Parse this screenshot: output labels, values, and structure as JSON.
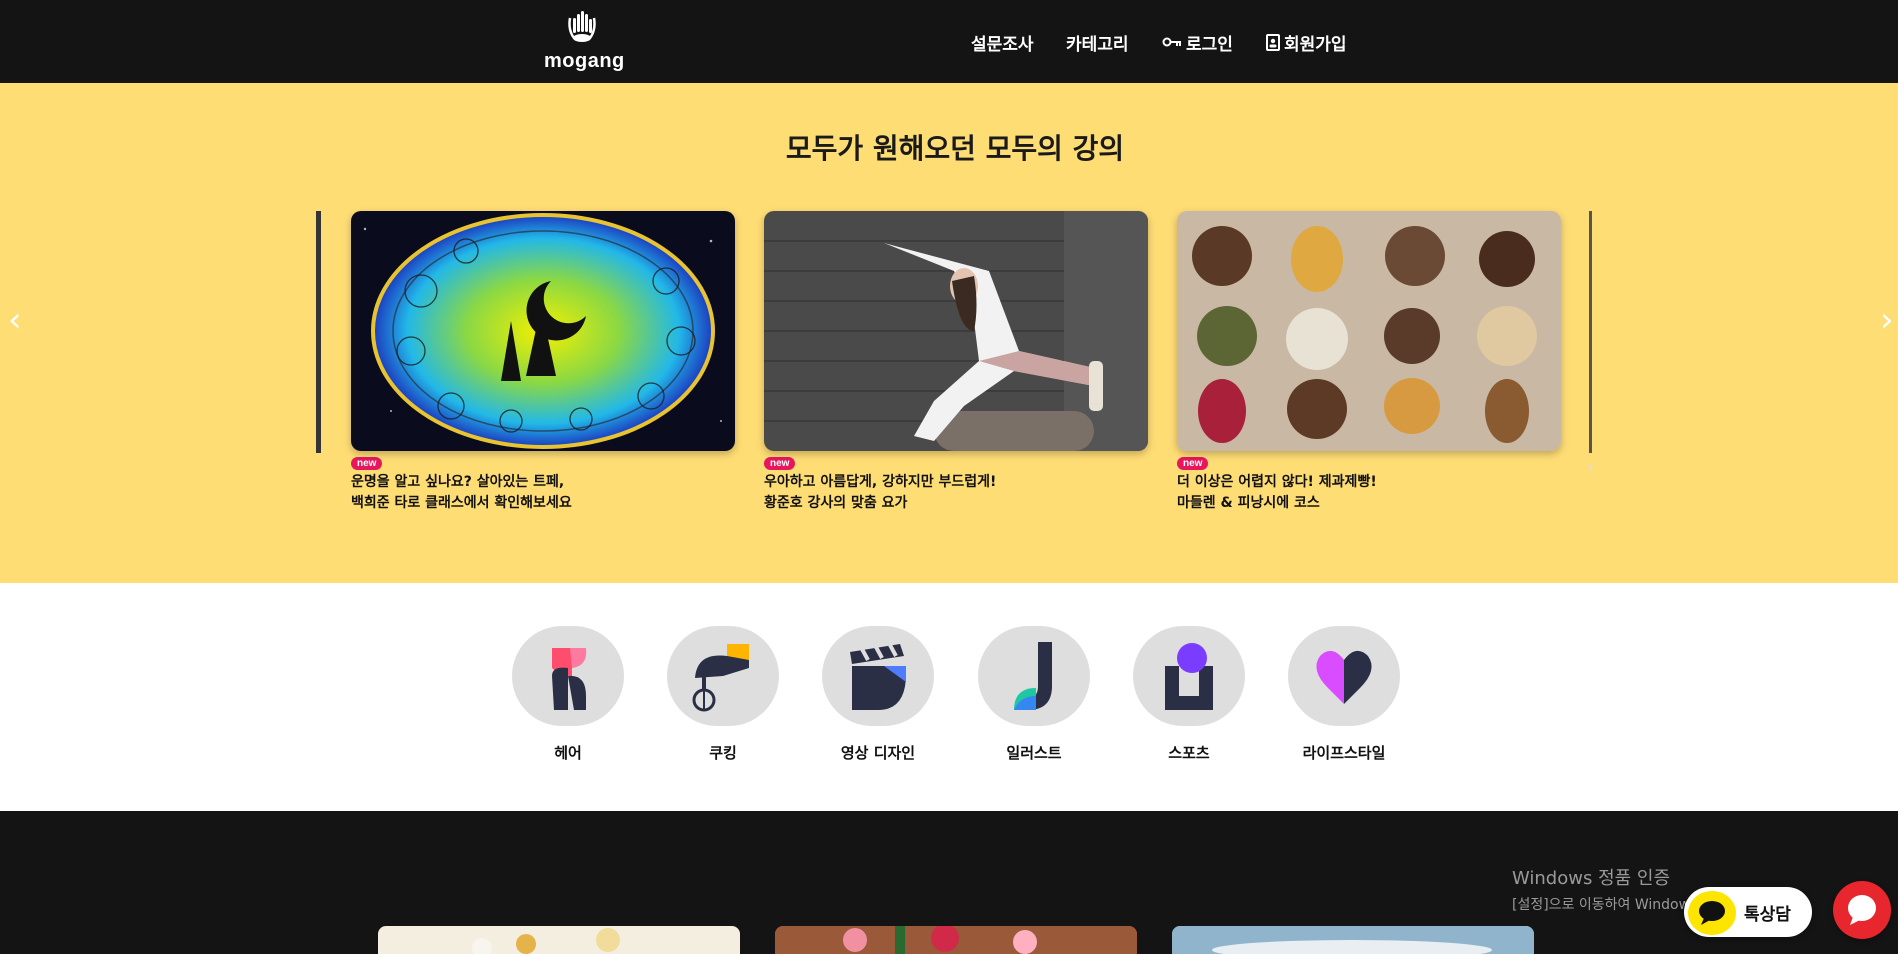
{
  "header": {
    "logo_text": "mogang",
    "nav": [
      {
        "label": "설문조사",
        "icon": ""
      },
      {
        "label": "카테고리",
        "icon": ""
      },
      {
        "label": "로그인",
        "icon": "key-icon"
      },
      {
        "label": "회원가입",
        "icon": "id-card-icon"
      }
    ]
  },
  "hero": {
    "title": "모두가 원해오던 모두의 강의",
    "cards": [
      {
        "badge": "new",
        "line1": "운명을 알고 싶나요? 살아있는 트페,",
        "line2": "백희준 타로 클래스에서 확인해보세요"
      },
      {
        "badge": "new",
        "line1": "우아하고 아름답게, 강하지만 부드럽게!",
        "line2": "황준호 강사의 맞춤 요가"
      },
      {
        "badge": "new",
        "line1": "더 이상은 어렵지 않다! 제과제빵!",
        "line2": "마들렌 & 피낭시에 코스"
      }
    ]
  },
  "categories": [
    {
      "label": "헤어",
      "icon": "hair-icon"
    },
    {
      "label": "쿠킹",
      "icon": "cooking-icon"
    },
    {
      "label": "영상 디자인",
      "icon": "clapperboard-icon"
    },
    {
      "label": "일러스트",
      "icon": "illustration-icon"
    },
    {
      "label": "스포츠",
      "icon": "sports-icon"
    },
    {
      "label": "라이프스타일",
      "icon": "heart-icon"
    }
  ],
  "overlay": {
    "windows_title": "Windows 정품 인증",
    "windows_sub": "[설정]으로 이동하여 Windows 정품 인증합니다.",
    "kakao_label": "톡상담"
  },
  "colors": {
    "header_bg": "#141414",
    "hero_bg": "#ffdd75",
    "badge": "#e8175d",
    "kakao_yellow": "#fee500",
    "chat_red": "#e8262d"
  }
}
